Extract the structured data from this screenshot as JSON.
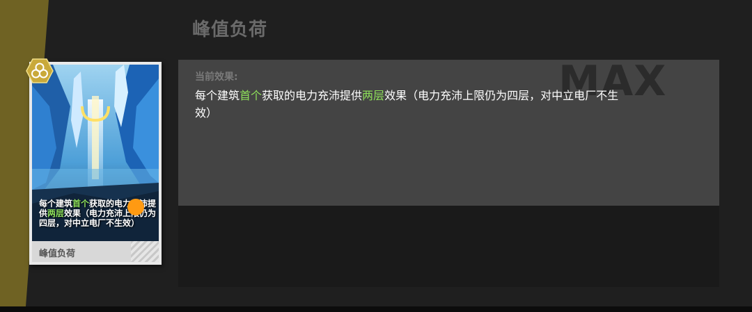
{
  "title": "峰值负荷",
  "max_label": "MAX",
  "effect": {
    "label": "当前效果:",
    "text_part1": "每个建筑",
    "text_hl1": "首个",
    "text_part2": "获取的电力充沛提供",
    "text_hl2": "两层",
    "text_part3": "效果（电力充沛上限仍为四层，对中立电厂不生效）"
  },
  "card": {
    "name": "峰值负荷",
    "desc_part1": "每个建筑",
    "desc_hl1": "首个",
    "desc_part2": "获取的电力充沛提供",
    "desc_hl2": "两层",
    "desc_part3": "效果（电力充沛上限仍为四层，对中立电厂不生效）",
    "badge_icon": "triple-circle-icon"
  },
  "colors": {
    "highlight": "#8ee05a",
    "gold": "#6f6223",
    "touch_indicator": "#ff9a12"
  }
}
